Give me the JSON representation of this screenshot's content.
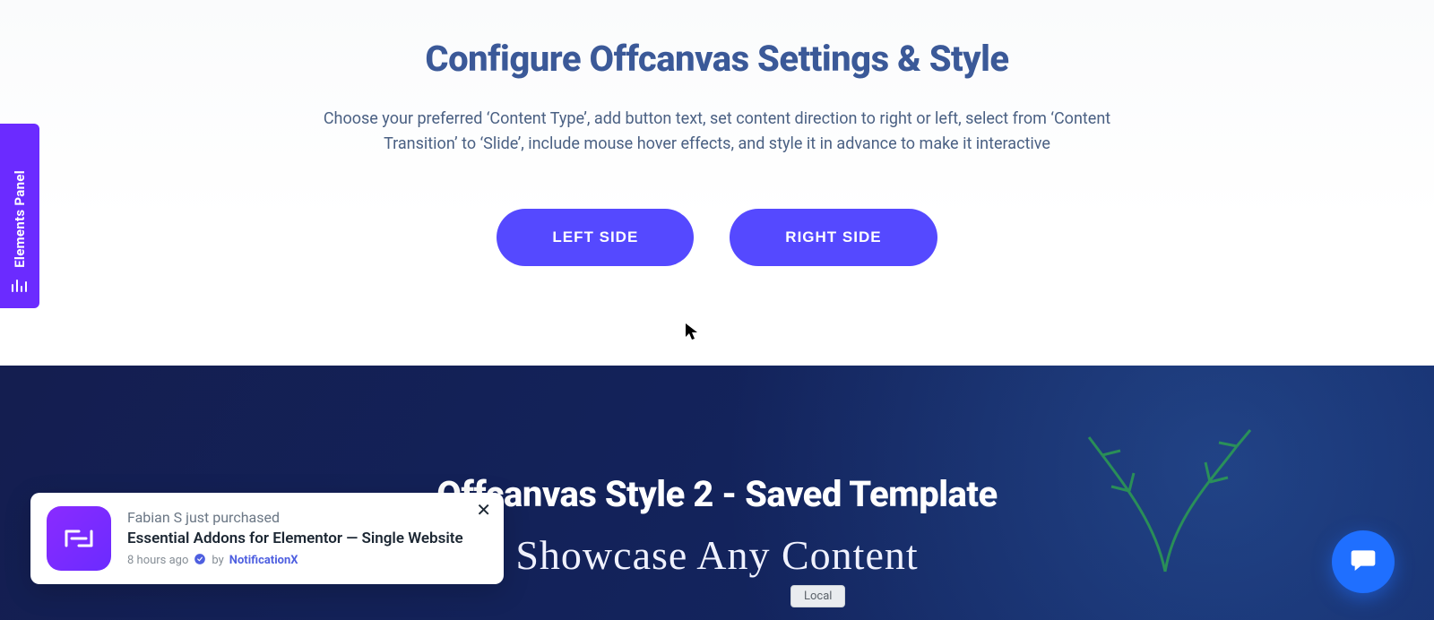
{
  "hero": {
    "title": "Configure Offcanvas Settings & Style",
    "description": "Choose your preferred ‘Content Type’, add button text, set content direction to right or left, select from ‘Content Transition’ to ‘Slide’, include mouse hover effects, and style it in advance to make it interactive",
    "left_button": "LEFT SIDE",
    "right_button": "RIGHT SIDE"
  },
  "side_tab": {
    "label": "Elements Panel"
  },
  "banner": {
    "title": "Offcanvas Style 2 - Saved Template",
    "subtitle": "Showcase Any Content",
    "local_badge": "Local"
  },
  "toast": {
    "line1": "Fabian S just purchased",
    "line2": "Essential Addons for Elementor — Single Website",
    "time": "8 hours ago",
    "by_label": "by",
    "brand": "NotificationX"
  }
}
